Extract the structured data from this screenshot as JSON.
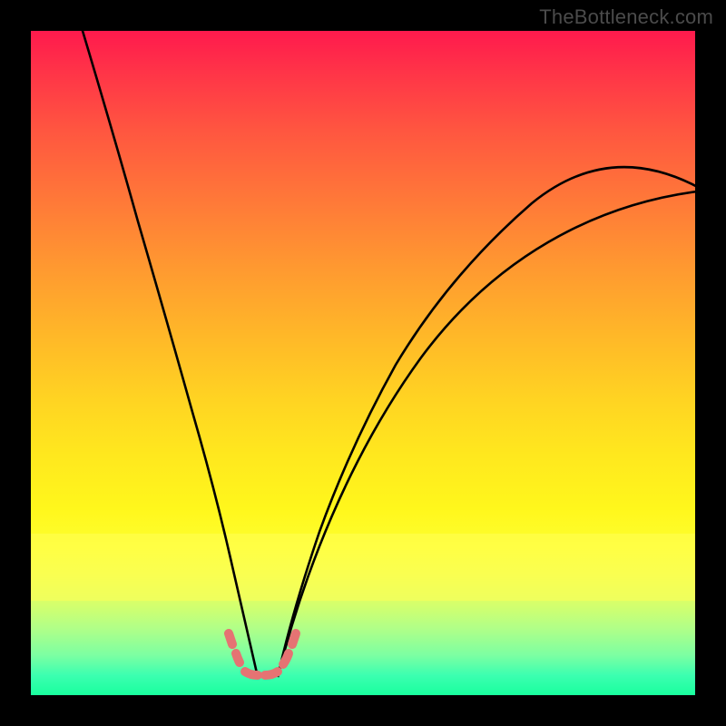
{
  "watermark": "TheBottleneck.com",
  "chart_data": {
    "type": "line",
    "title": "",
    "xlabel": "",
    "ylabel": "",
    "xlim": [
      0,
      100
    ],
    "ylim": [
      0,
      100
    ],
    "grid": false,
    "legend": "none",
    "description": "Bottleneck curve over rainbow gradient. Two black curves descend from the top edges to a shared minimum near x≈33; a short pink dotted segment marks the trough.",
    "series": [
      {
        "name": "left-branch",
        "x": [
          6,
          9,
          12,
          15,
          18,
          21,
          24,
          27,
          30,
          33
        ],
        "y": [
          100,
          84,
          69,
          55,
          42,
          31,
          21,
          12,
          5,
          1
        ]
      },
      {
        "name": "right-branch",
        "x": [
          33,
          36,
          40,
          45,
          50,
          56,
          63,
          71,
          80,
          90,
          100
        ],
        "y": [
          1,
          5,
          11,
          19,
          27,
          35,
          44,
          53,
          61,
          69,
          76
        ]
      },
      {
        "name": "trough-marker",
        "style": "dotted-pink",
        "x": [
          28,
          30,
          32,
          34,
          36,
          38
        ],
        "y": [
          7,
          3,
          1,
          1,
          3,
          7
        ]
      }
    ],
    "gradient_stops": [
      {
        "pos": 0.0,
        "color": "#ff1a4d"
      },
      {
        "pos": 0.15,
        "color": "#ff5640"
      },
      {
        "pos": 0.36,
        "color": "#ff9a30"
      },
      {
        "pos": 0.56,
        "color": "#ffd522"
      },
      {
        "pos": 0.72,
        "color": "#fff71c"
      },
      {
        "pos": 0.86,
        "color": "#d8ff6a"
      },
      {
        "pos": 1.0,
        "color": "#19ff9e"
      }
    ]
  }
}
